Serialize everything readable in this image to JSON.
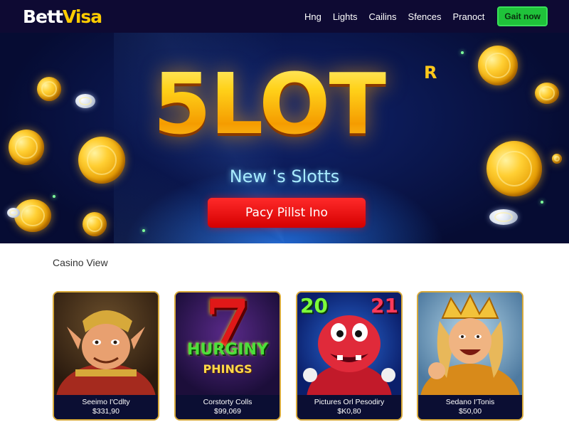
{
  "nav": {
    "logo_part1": "Bett",
    "logo_part2": "Visa",
    "links": [
      "Hng",
      "Lights",
      "Cailins",
      "Sfences",
      "Pranoct"
    ],
    "cta_label": "Gait now"
  },
  "hero": {
    "title": "5LOT",
    "title_superscript": "R",
    "subtitle": "New 's Slotts",
    "button_label": "Pacy Pillst Ino"
  },
  "section": {
    "title": "Casino View"
  },
  "cards": [
    {
      "name": "Seeimo I'Cdlty",
      "price": "$331,90",
      "art": "jester-character-illustration"
    },
    {
      "name": "Corstorty Colls",
      "price": "$99,069",
      "art_text_top": "7",
      "art_text_mid": "HURGINY",
      "art_text_bottom": "PHINGS"
    },
    {
      "name": "Pictures Orl Pesodiry",
      "price": "$K0,80",
      "art_number_left": "20",
      "art_number_right": "21",
      "art": "red-monster-character-illustration"
    },
    {
      "name": "Sedano I'Tonis",
      "price": "$50,00",
      "art": "golden-king-character-illustration"
    }
  ],
  "colors": {
    "nav_bg": "#0e0a33",
    "brand_yellow": "#ffcc00",
    "cta_green": "#1fc23a",
    "hero_button_red": "#e00000",
    "card_border_gold": "#d7a93a"
  }
}
